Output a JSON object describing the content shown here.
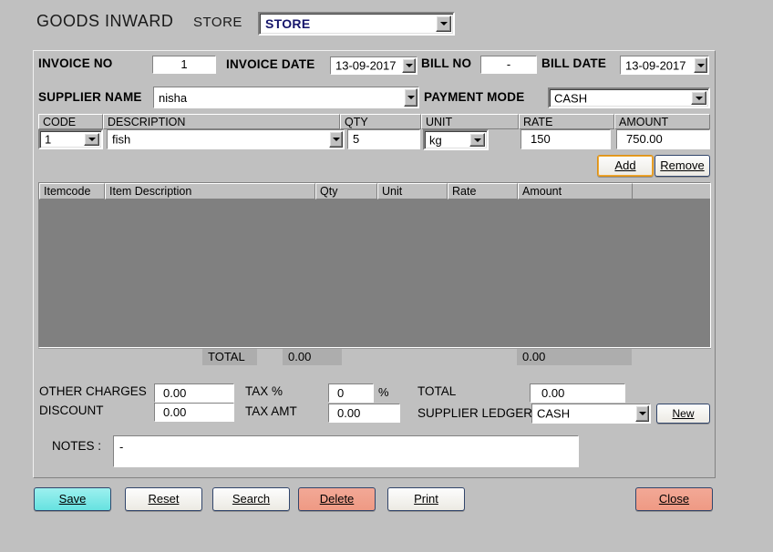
{
  "header": {
    "title": "GOODS INWARD",
    "store_label": "STORE",
    "store_value": "STORE"
  },
  "invoice": {
    "invoice_no_label": "INVOICE NO",
    "invoice_no_value": "1",
    "invoice_date_label": "INVOICE DATE",
    "invoice_date_value": "13-09-2017",
    "bill_no_label": "BILL NO",
    "bill_no_value": "-",
    "bill_date_label": "BILL DATE",
    "bill_date_value": "13-09-2017",
    "supplier_name_label": "SUPPLIER NAME",
    "supplier_name_value": "nisha",
    "payment_mode_label": "PAYMENT MODE",
    "payment_mode_value": "CASH"
  },
  "entry": {
    "code_label": "CODE",
    "code_value": "1",
    "description_label": "DESCRIPTION",
    "description_value": "fish",
    "qty_label": "QTY",
    "qty_value": "5",
    "unit_label": "UNIT",
    "unit_value": "kg",
    "rate_label": "RATE",
    "rate_value": "150",
    "amount_label": "AMOUNT",
    "amount_value": "750.00",
    "add_label": "Add",
    "remove_label": "Remove"
  },
  "grid": {
    "columns": [
      {
        "label": "Itemcode"
      },
      {
        "label": "Item Description"
      },
      {
        "label": "Qty"
      },
      {
        "label": "Unit"
      },
      {
        "label": "Rate"
      },
      {
        "label": "Amount"
      }
    ],
    "rows": [],
    "total_label": "TOTAL",
    "total_qty": "0.00",
    "total_amount": "0.00"
  },
  "totals": {
    "other_charges_label": "OTHER CHARGES",
    "other_charges_value": "0.00",
    "discount_label": "DISCOUNT",
    "discount_value": "0.00",
    "tax_pct_label": "TAX %",
    "tax_pct_value": "0",
    "tax_pct_sign": "%",
    "tax_amt_label": "TAX AMT",
    "tax_amt_value": "0.00",
    "total_label": "TOTAL",
    "total_value": "0.00",
    "supplier_ledger_label": "SUPPLIER LEDGER",
    "supplier_ledger_value": "CASH",
    "new_label": "New"
  },
  "notes": {
    "label": "NOTES :",
    "value": "-"
  },
  "actions": {
    "save": "Save",
    "reset": "Reset",
    "search": "Search",
    "delete": "Delete",
    "print": "Print",
    "close": "Close"
  },
  "colors": {
    "face": "#c0c0c0",
    "grid_body": "#808080",
    "save_accent": "#66e2e0",
    "delete_accent": "#ef9a84",
    "focus_accent": "#d98f17",
    "combo_text": "#16166b"
  }
}
